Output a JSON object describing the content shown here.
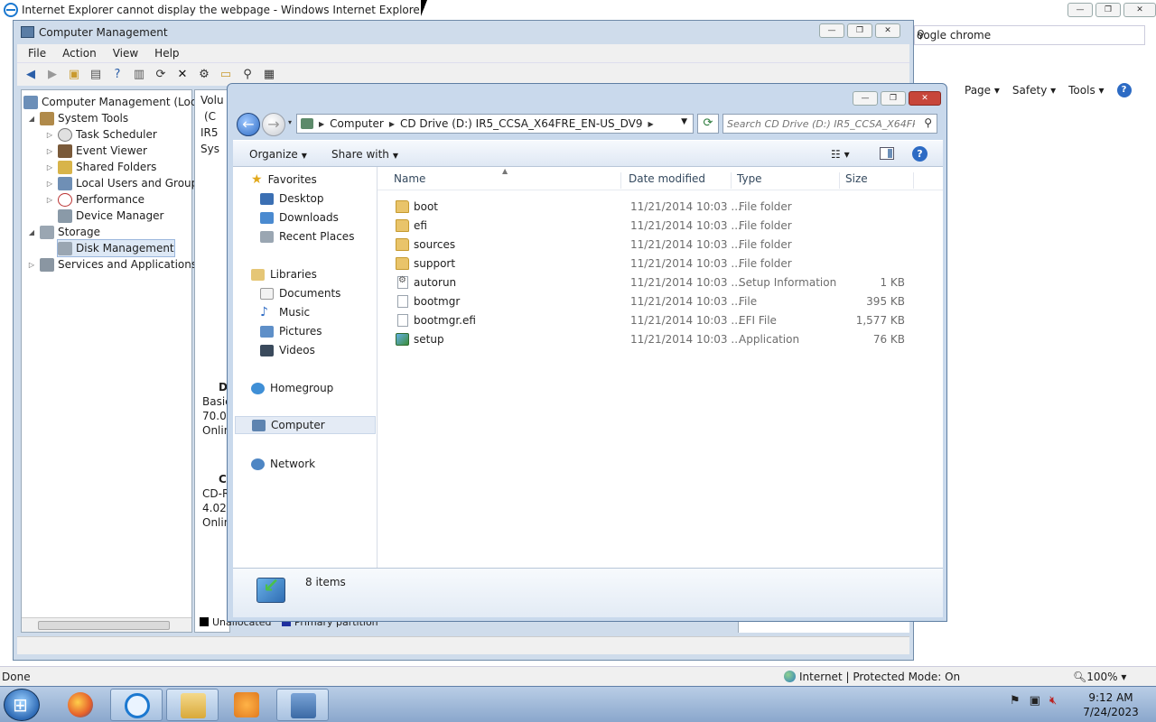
{
  "ie": {
    "title": "Internet Explorer cannot display the webpage - Windows Internet Explorer",
    "address_partial": "oogle chrome",
    "commands": [
      "Page",
      "Safety",
      "Tools"
    ],
    "status": {
      "done": "Done",
      "zone": "Internet | Protected Mode: On",
      "zoom": "100%"
    }
  },
  "computer_management": {
    "title": "Computer Management",
    "menu": [
      "File",
      "Action",
      "View",
      "Help"
    ],
    "tree": [
      {
        "label": "Computer Management (Local",
        "level": 0
      },
      {
        "label": "System Tools",
        "level": 1
      },
      {
        "label": "Task Scheduler",
        "level": 2
      },
      {
        "label": "Event Viewer",
        "level": 2
      },
      {
        "label": "Shared Folders",
        "level": 2
      },
      {
        "label": "Local Users and Groups",
        "level": 2
      },
      {
        "label": "Performance",
        "level": 2
      },
      {
        "label": "Device Manager",
        "level": 2
      },
      {
        "label": "Storage",
        "level": 1
      },
      {
        "label": "Disk Management",
        "level": 2,
        "selected": true
      },
      {
        "label": "Services and Applications",
        "level": 1
      }
    ],
    "mid_labels": {
      "volume": "Volu",
      "c_prefix": "(C",
      "ir5": "IR5",
      "sys": "Sys",
      "disk0": "D",
      "basic": "Basic",
      "size0": "70.00",
      "online0": "Onlin",
      "cd": "C",
      "cdr": "CD-R",
      "size1": "4.02",
      "online1": "Onlin"
    },
    "legend": {
      "unallocated": "Unallocated",
      "primary": "Primary partition"
    }
  },
  "explorer": {
    "breadcrumb": [
      "Computer",
      "CD Drive (D:) IR5_CCSA_X64FRE_EN-US_DV9"
    ],
    "search_placeholder": "Search CD Drive (D:) IR5_CCSA_X64FR...",
    "commands": {
      "organize": "Organize",
      "share": "Share with"
    },
    "nav": {
      "favorites": "Favorites",
      "desktop": "Desktop",
      "downloads": "Downloads",
      "recent": "Recent Places",
      "libraries": "Libraries",
      "documents": "Documents",
      "music": "Music",
      "pictures": "Pictures",
      "videos": "Videos",
      "homegroup": "Homegroup",
      "computer": "Computer",
      "network": "Network"
    },
    "columns": [
      "Name",
      "Date modified",
      "Type",
      "Size"
    ],
    "files": [
      {
        "name": "boot",
        "date": "11/21/2014 10:03 ...",
        "type": "File folder",
        "size": "",
        "icon": "folder"
      },
      {
        "name": "efi",
        "date": "11/21/2014 10:03 ...",
        "type": "File folder",
        "size": "",
        "icon": "folder"
      },
      {
        "name": "sources",
        "date": "11/21/2014 10:03 ...",
        "type": "File folder",
        "size": "",
        "icon": "folder"
      },
      {
        "name": "support",
        "date": "11/21/2014 10:03 ...",
        "type": "File folder",
        "size": "",
        "icon": "folder"
      },
      {
        "name": "autorun",
        "date": "11/21/2014 10:03 ...",
        "type": "Setup Information",
        "size": "1 KB",
        "icon": "inf"
      },
      {
        "name": "bootmgr",
        "date": "11/21/2014 10:03 ...",
        "type": "File",
        "size": "395 KB",
        "icon": "file"
      },
      {
        "name": "bootmgr.efi",
        "date": "11/21/2014 10:03 ...",
        "type": "EFI File",
        "size": "1,577 KB",
        "icon": "file"
      },
      {
        "name": "setup",
        "date": "11/21/2014 10:03 ...",
        "type": "Application",
        "size": "76 KB",
        "icon": "app"
      }
    ],
    "item_count": "8 items"
  },
  "taskbar": {
    "time": "9:12 AM",
    "date": "7/24/2023"
  },
  "colors": {
    "accent": "#2f6cc4",
    "folder": "#e9c46a",
    "taskbar": "#8aa7cc"
  }
}
